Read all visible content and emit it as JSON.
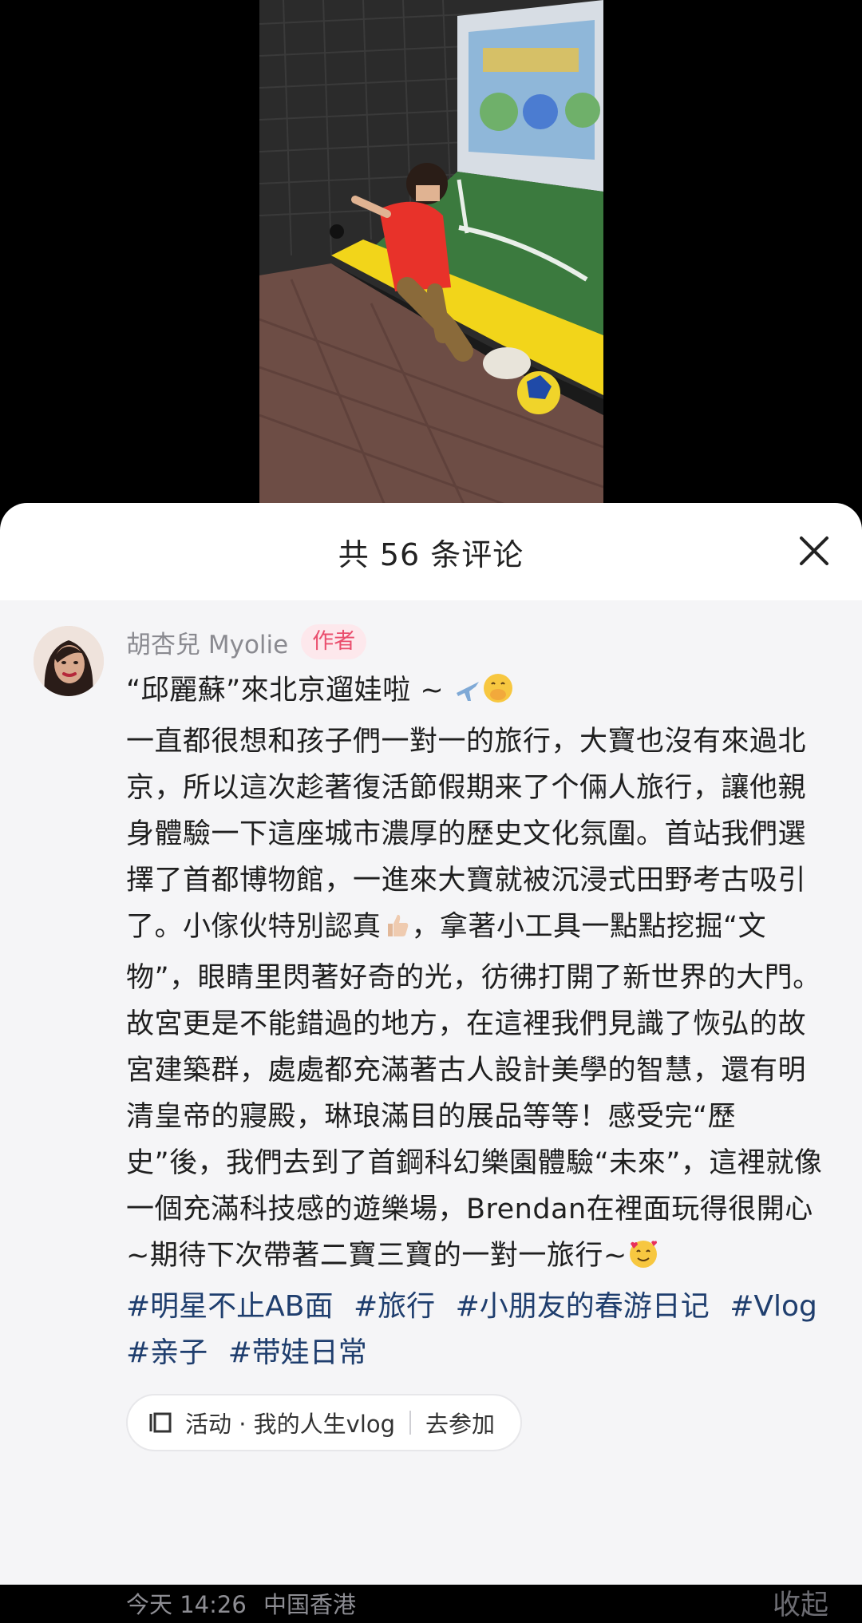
{
  "sheet": {
    "title": "共 56 条评论",
    "close_icon": "close-icon"
  },
  "comment": {
    "author": "胡杏兒 Myolie",
    "badge": "作者",
    "text_line1": "“邱麗蘇”來北京遛娃啦 ~ ",
    "text_body": "一直都很想和孩子們一對一的旅行，大寶也沒有來過北京，所以這次趁著復活節假期来了个倆人旅行，讓他親身體驗一下這座城市濃厚的歷史文化氛圍。首站我們選擇了首都博物館，一進來大寶就被沉浸式田野考古吸引了。小傢伙特別認真",
    "text_body2": "，拿著小工具一點點挖掘“文物”，眼睛里閃著好奇的光，彷彿打開了新世界的大門。故宮更是不能錯過的地方，在這裡我們見識了恢弘的故宮建築群，處處都充滿著古人設計美學的智慧，還有明清皇帝的寢殿，琳琅滿目的展品等等！感受完“歷史”後，我們去到了首鋼科幻樂園體驗“未來”，這裡就像一個充滿科技感的遊樂場，Brendan在裡面玩得很開心~期待下次帶著二寶三寶的一對一旅行~",
    "hashtags": [
      "#明星不止AB面",
      "#旅行",
      "#小朋友的春游日记",
      "#Vlog",
      "#亲子",
      "#带娃日常"
    ],
    "activity": {
      "label": "活动 · 我的人生vlog",
      "action": "去参加"
    },
    "time": "今天 14:26",
    "location": "中国香港",
    "collapse": "收起"
  },
  "colors": {
    "badge": "#ea4e6d",
    "hashtag": "#1f3e6e",
    "meta": "#8d8d93"
  }
}
